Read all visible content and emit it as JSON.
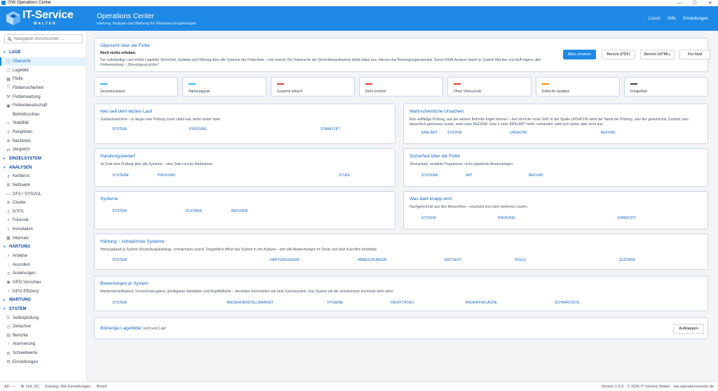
{
  "window": {
    "title": "ISW Operations Center",
    "controls": [
      "—",
      "☐",
      "✕"
    ]
  },
  "header": {
    "brand": "IT-Service",
    "brand_sub": "WALTER",
    "title": "Operations Center",
    "subtitle": "Härtung, Analyse und Wartung für Windows-Umgebungen",
    "nav": [
      "Lizenz",
      "Hilfe",
      "Einstellungen"
    ]
  },
  "sidebar": {
    "search_placeholder": "Navigation durchsuchen ...",
    "sections": [
      {
        "label": "LAGE",
        "items": [
          {
            "label": "Übersicht",
            "icon": "info-icon",
            "glyph": "ⓘ",
            "active": true
          },
          {
            "label": "Lagebild",
            "icon": "doc-icon",
            "glyph": "▢"
          },
          {
            "label": "Flotte",
            "icon": "grid-icon",
            "glyph": "▦"
          },
          {
            "label": "Flottensicherheit",
            "icon": "shield-icon",
            "glyph": "⛉"
          },
          {
            "label": "Flottenwartung",
            "icon": "wrench-icon",
            "glyph": "⚒"
          },
          {
            "label": "Flottenbereitschaft",
            "icon": "ready-icon",
            "glyph": "▣"
          },
          {
            "label": "Betriebsschau",
            "icon": "none",
            "glyph": ""
          },
          {
            "label": "Stabilität",
            "icon": "pulse-icon",
            "glyph": "∿"
          },
          {
            "label": "Ranglisten",
            "icon": "list-icon",
            "glyph": "≡"
          },
          {
            "label": "Nachweis",
            "icon": "seal-icon",
            "glyph": "⊛"
          },
          {
            "label": "Vergleich",
            "icon": "compare-icon",
            "glyph": "⇄"
          }
        ]
      },
      {
        "label": "EINZELSYSTEM",
        "items": []
      },
      {
        "label": "ANALYSEN",
        "items": [
          {
            "label": "Kerberos",
            "icon": "key-icon",
            "glyph": "⚷"
          },
          {
            "label": "Netzwerk",
            "icon": "network-icon",
            "glyph": "⊞"
          },
          {
            "label": "DFS / SYSVOL",
            "icon": "folder-icon",
            "glyph": "▭"
          },
          {
            "label": "Cluster",
            "icon": "cluster-icon",
            "glyph": "⧈"
          },
          {
            "label": "NTFS",
            "icon": "file-icon",
            "glyph": "▯"
          },
          {
            "label": "Forensik",
            "icon": "magnifier-icon",
            "glyph": "⌕"
          },
          {
            "label": "Korrelation",
            "icon": "chart-icon",
            "glyph": "⌇"
          },
          {
            "label": "Internals",
            "icon": "chip-icon",
            "glyph": "▩"
          }
        ]
      },
      {
        "label": "HÄRTUNG",
        "items": [
          {
            "label": "Analyse",
            "icon": "analysis-icon",
            "glyph": "⌕"
          },
          {
            "label": "Ausrollen",
            "icon": "download-icon",
            "glyph": "↓"
          },
          {
            "label": "Änderungen",
            "icon": "history-icon",
            "glyph": "↺"
          },
          {
            "label": "GPO-Vorschau",
            "icon": "eye-icon",
            "glyph": "◉"
          },
          {
            "label": "GPO-Effizienz",
            "icon": "gauge-icon",
            "glyph": "◔"
          }
        ]
      },
      {
        "label": "WARTUNG",
        "items": []
      },
      {
        "label": "SYSTEM",
        "items": [
          {
            "label": "Selbstprüfung",
            "icon": "check-icon",
            "glyph": "☑"
          },
          {
            "label": "Zeitachse",
            "icon": "clock-icon",
            "glyph": "◷"
          },
          {
            "label": "Berichte",
            "icon": "report-icon",
            "glyph": "▤"
          },
          {
            "label": "Alarmierung",
            "icon": "bell-icon",
            "glyph": "♪"
          },
          {
            "label": "Schwellwerte",
            "icon": "gear-icon",
            "glyph": "⚙"
          },
          {
            "label": "Einstellungen",
            "icon": "settings-icon",
            "glyph": "⚙"
          }
        ]
      }
    ]
  },
  "overview": {
    "title": "Übersicht über die Flotte",
    "status": "Noch nichts erhoben.",
    "desc": "Der vollständige Lauf erhebt Lagebild, Sicherheit, Updates und Härtung über alle Systeme der Flottenliste – rein lesend. Die Dateisuche der Sicherheitsaufnahme bleibt dabei aus, ebenso das Bereinigungspotenzial. Deren DISM-Analyse dauert je System Minuten und läuft eigens über Flottenwartung – „Bereinigung prüfen“.",
    "buttons": [
      "Alles erheben",
      "Bericht (PDF)",
      "Bericht (HTML)",
      "Per Mail"
    ]
  },
  "kpis": [
    {
      "label": "Gesamtzustand",
      "color": "#29b6f6"
    },
    {
      "label": "Härtungsgrad",
      "color": "#29b6f6"
    },
    {
      "label": "Systeme kritisch",
      "color": "#e53935"
    },
    {
      "label": "Nicht erreicht",
      "color": "#e53935"
    },
    {
      "label": "Ohne Virenschutz",
      "color": "#e53935"
    },
    {
      "label": "Kritische Updates",
      "color": "#fb8c00"
    },
    {
      "label": "Freigebbar",
      "color": "#424242"
    }
  ],
  "cards": {
    "new": {
      "title": "Neu seit dem letzten Lauf",
      "desc": "Zustandswechsel – je länger eine Prüfung zuvor stabil war, desto weiter oben.",
      "cols": [
        "SYSTEM",
        "PRÜFUNG",
        "STABILITÄT"
      ]
    },
    "causes": {
      "title": "Wahrscheinliche Ursachen",
      "desc": "Eine auffällige Prüfung, aus der weitere Befunde folgen können – hier lohnt der erste Griff. In der Spalte URSACHE steht der Name der Prüfung, also der gewünschte Zustand; was tatsächlich gemessen wurde, steht unter BEFUND. Eine 0 unter ERKLÄRT heißt: vorhanden, wirkt sich bisher aber nicht aus.",
      "cols": [
        "ERKLÄRT",
        "SYSTEM",
        "URSACHE",
        "BEFUND"
      ]
    },
    "action": {
      "title": "Handlungsbedarf",
      "desc": "Je Zeile eine Prüfung über alle Systeme – eine Zeile ist eine Maßnahme.",
      "cols": [
        "SYSTEME",
        "PRÜFUNG",
        "STUFE"
      ]
    },
    "security": {
      "title": "Sicherheit über die Flotte",
      "desc": "Virenschutz, veraltete Programme, nicht registrierte Anwendungen.",
      "cols": [
        "SYSTEME",
        "ART",
        "BEFUND"
      ]
    },
    "systems": {
      "title": "Systeme",
      "desc": "",
      "cols": [
        "SYSTEM",
        "ZUSTAND",
        "BEFUNDE"
      ]
    },
    "soon": {
      "title": "Was bald knapp wird",
      "desc": "Hochgerechnet aus den Messreihen – erscheint erst nach mehreren Läufen.",
      "cols": [
        "SYSTEM",
        "PRÜFUNG",
        "ERREICHT"
      ]
    },
    "hardening": {
      "title": "Härtung – schwächste Systeme",
      "desc": "Härtungsgrad je System (Einstellungskatalog), schwächstes zuerst. Doppelklick öffnet das System in der Analyse – dort alle Abweichungen im Detail und über  Ausrollen  behebbar.",
      "cols": [
        "SYSTEM",
        "HÄRTUNGSGRAD",
        "ABWEICHUNGEN",
        "KRITISCH",
        "ROLLE",
        "ZUSTAND"
      ]
    },
    "ratings": {
      "title": "Bewertungen je System",
      "desc": "Wiederherstellbarkeit, Verzeichnishygiene, privilegierte Identitäten und Angriffsfläche – dieselben Kennzahlen wie beim Einzelsystem. Das System mit der schwächsten Kennzahl steht oben.",
      "cols": [
        "SYSTEM",
        "WIEDERHERSTELLBARKEIT",
        "HYGIENE",
        "IDENTITÄTEN",
        "ANGRIFFSFLÄCHE",
        "SCHWÄCHSTE"
      ]
    },
    "history": {
      "title": "Bisherige Lagebilder",
      "note": "noch kein Lauf",
      "button": "Aufklappen"
    }
  },
  "statusbar": {
    "user": "AD: —",
    "time": "Zeit: DC",
    "catalog": "Katalog: 366 Einstellungen",
    "state": "Bereit",
    "right": "Version 1.6.0  ·  © 2026 IT-Service Walter · isw.operationscenter.de"
  }
}
